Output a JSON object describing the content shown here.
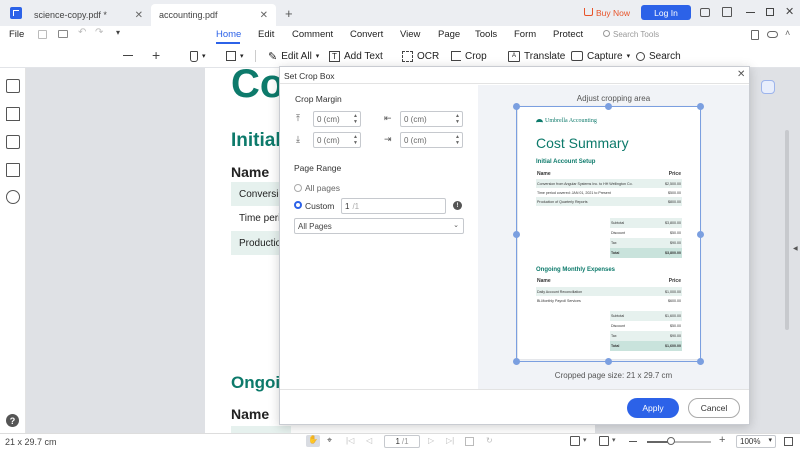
{
  "tabs": [
    {
      "label": "science-copy.pdf *"
    },
    {
      "label": "accounting.pdf"
    }
  ],
  "titlebar": {
    "buy_now": "Buy Now",
    "login": "Log In"
  },
  "menu": {
    "file": "File",
    "items": [
      "Home",
      "Edit",
      "Comment",
      "Convert",
      "View",
      "Page",
      "Tools",
      "Form",
      "Protect"
    ],
    "search_tools": "Search Tools"
  },
  "toolbar": {
    "edit_all": "Edit All",
    "add_text": "Add Text",
    "ocr": "OCR",
    "crop": "Crop",
    "translate": "Translate",
    "capture": "Capture",
    "search": "Search"
  },
  "background_doc": {
    "title_fragment": "Co",
    "h_initial": "Initial",
    "name1": "Name",
    "rows": [
      "Conversio",
      "Time perio",
      "Production"
    ],
    "h_ongoing": "Ongoi",
    "name2": "Name"
  },
  "dialog": {
    "title": "Set Crop Box",
    "crop_margin": "Crop Margin",
    "margins": {
      "top": "0 (cm)",
      "left": "0 (cm)",
      "bottom": "0 (cm)",
      "right": "0 (cm)"
    },
    "page_range": "Page Range",
    "all_pages": "All pages",
    "custom": "Custom",
    "custom_value": "1",
    "custom_total": "/1",
    "pages_select": "All Pages",
    "preview_label": "Adjust cropping area",
    "page_size": "Cropped page size: 21 x 29.7 cm",
    "apply": "Apply",
    "cancel": "Cancel"
  },
  "preview_doc": {
    "brand": "Umbrella Accounting",
    "title": "Cost Summary",
    "section1": "Initial Account Setup",
    "col_name": "Name",
    "col_price": "Price",
    "rows1": [
      {
        "name": "Conversion from Angular Systems Inc. to HH Wellington Co.",
        "price": "$2,500.00"
      },
      {
        "name": "Time period covered: JAN 01, 2021 to Present",
        "price": "$500.00"
      },
      {
        "name": "Production of Quarterly Reports",
        "price": "$800.00"
      }
    ],
    "totals1": [
      {
        "label": "Subtotal",
        "value": "$3,800.00"
      },
      {
        "label": "Discount",
        "value": "$50.00"
      },
      {
        "label": "Tax",
        "value": "$90.00"
      },
      {
        "label": "Total",
        "value": "$3,800.00"
      }
    ],
    "section2": "Ongoing Monthly Expenses",
    "rows2": [
      {
        "name": "Daily Account Reconciliation",
        "price": "$1,000.00"
      },
      {
        "name": "Bi-Monthly Payroll Services",
        "price": "$600.00"
      }
    ],
    "totals2": [
      {
        "label": "Subtotal",
        "value": "$1,600.00"
      },
      {
        "label": "Discount",
        "value": "$50.00"
      },
      {
        "label": "Tax",
        "value": "$90.00"
      },
      {
        "label": "Total",
        "value": "$1,600.00"
      }
    ]
  },
  "status": {
    "page_size": "21 x 29.7 cm",
    "page_input": "1",
    "page_total": "/1",
    "zoom": "100%"
  },
  "colors": {
    "accent": "#2c62e8",
    "teal": "#0d7a6b",
    "buy_now": "#e8542a"
  }
}
